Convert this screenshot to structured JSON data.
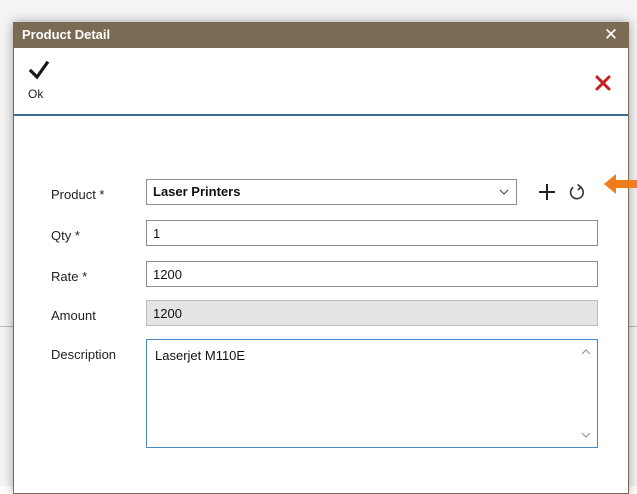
{
  "window": {
    "title": "Product Detail",
    "close_symbol": "✕"
  },
  "toolbar": {
    "ok_label": "Ok",
    "ok_icon": "checkmark-icon",
    "cancel_icon": "red-x-icon"
  },
  "form": {
    "product": {
      "label": "Product *",
      "value": "Laser Printers"
    },
    "qty": {
      "label": "Qty *",
      "value": "1"
    },
    "rate": {
      "label": "Rate *",
      "value": "1200"
    },
    "amount": {
      "label": "Amount",
      "value": "1200"
    },
    "description": {
      "label": "Description",
      "value": "Laserjet M110E"
    }
  },
  "icons": {
    "add": "plus-icon",
    "refresh": "refresh-icon",
    "annotation": "orange-arrow-icon"
  },
  "colors": {
    "titlebar": "#7b6b55",
    "cancel": "#c81e1e",
    "accent": "#3d6c93",
    "annotation": "#f07c1a"
  }
}
